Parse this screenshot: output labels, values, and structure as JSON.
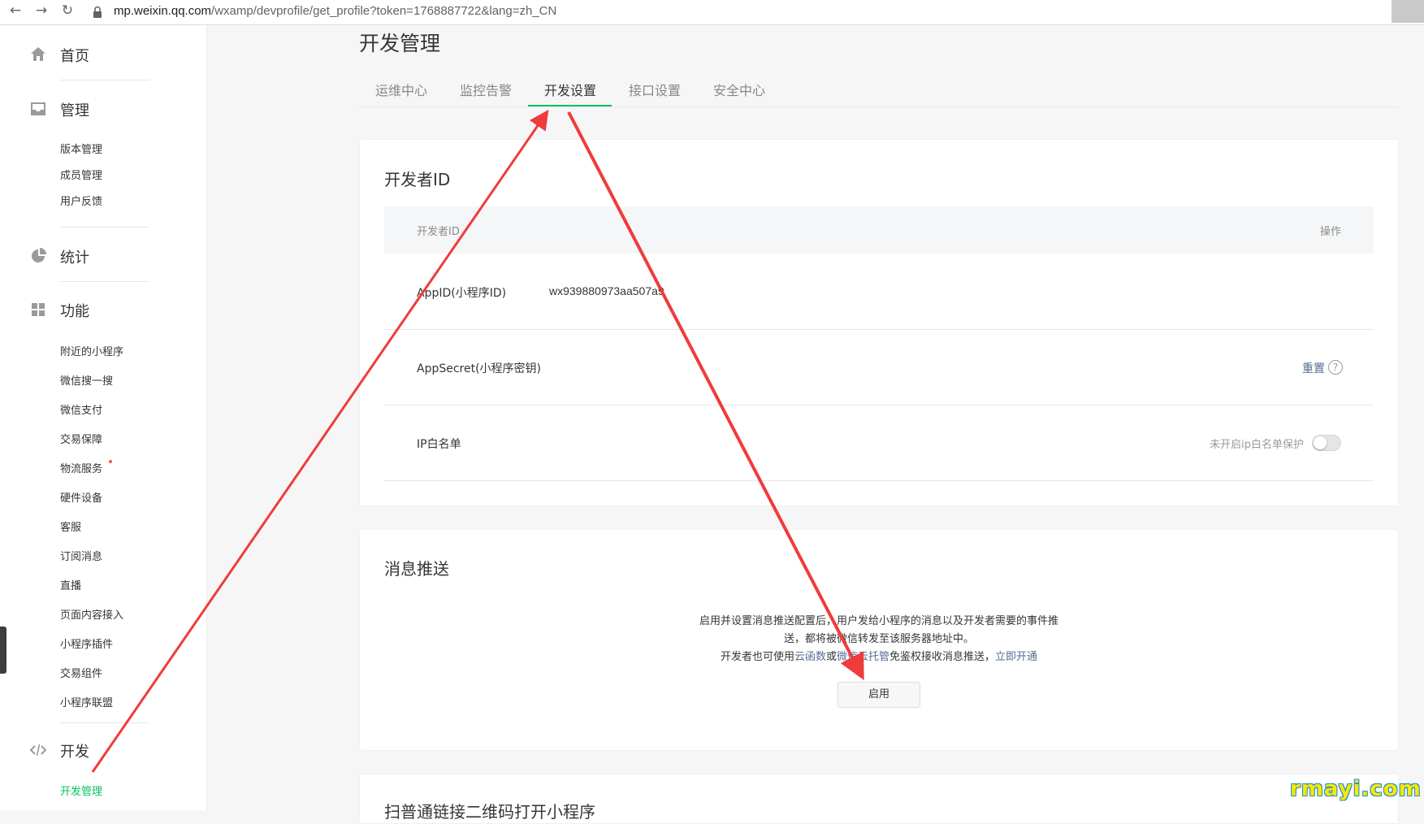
{
  "browser": {
    "back_icon": "←",
    "forward_icon": "→",
    "reload_icon": "↻",
    "url_host": "mp.weixin.qq.com",
    "url_path": "/wxamp/devprofile/get_profile?token=1768887722&lang=zh_CN"
  },
  "sidebar": {
    "home": "首页",
    "manage": "管理",
    "manage_items": [
      "版本管理",
      "成员管理",
      "用户反馈"
    ],
    "stats": "统计",
    "features": "功能",
    "feature_items": [
      "附近的小程序",
      "微信搜一搜",
      "微信支付",
      "交易保障",
      "物流服务",
      "硬件设备",
      "客服",
      "订阅消息",
      "直播",
      "页面内容接入",
      "小程序插件",
      "交易组件",
      "小程序联盟"
    ],
    "dev": "开发",
    "dev_items": [
      "开发管理"
    ]
  },
  "main": {
    "title": "开发管理",
    "tabs": [
      "运维中心",
      "监控告警",
      "开发设置",
      "接口设置",
      "安全中心"
    ],
    "active_tab": "开发设置"
  },
  "developer_id": {
    "title": "开发者ID",
    "col_id": "开发者ID",
    "col_op": "操作",
    "appid_label": "AppID(小程序ID)",
    "appid_value": "wx939880973aa507a9",
    "secret_label": "AppSecret(小程序密钥)",
    "secret_action": "重置",
    "help_icon": "?",
    "ip_label": "IP白名单",
    "ip_status": "未开启ip白名单保护",
    "ip_toggle_on": false
  },
  "message_push": {
    "title": "消息推送",
    "desc_line1": "启用并设置消息推送配置后，用户发给小程序的消息以及开发者需要的事件推",
    "desc_line2": "送，都将被微信转发至该服务器地址中。",
    "desc_line3_a": "开发者也可使用",
    "desc_line3_link1": "云函数",
    "desc_line3_b": "或",
    "desc_line3_link2": "微信云托管",
    "desc_line3_c": "免鉴权接收消息推送，",
    "desc_line3_link3": "立即开通",
    "enable_button": "启用"
  },
  "next_section": {
    "title": "扫普通链接二维码打开小程序"
  },
  "watermark": "rmayi.com",
  "colors": {
    "accent": "#07c160",
    "link": "#576b95",
    "arrow": "#f03b3b"
  }
}
